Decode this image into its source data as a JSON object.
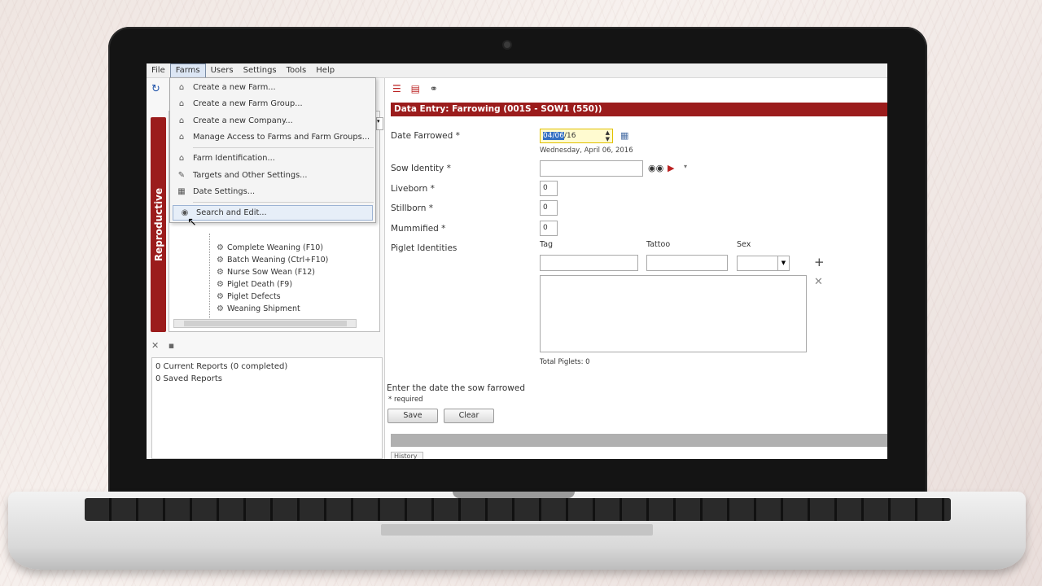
{
  "menubar": {
    "items": [
      "File",
      "Farms",
      "Users",
      "Settings",
      "Tools",
      "Help"
    ],
    "active": "Farms"
  },
  "farms_menu": {
    "items": [
      {
        "label": "Create a new Farm...",
        "icon": "farm-icon"
      },
      {
        "label": "Create a new Farm Group...",
        "icon": "farm-group-icon"
      },
      {
        "label": "Create a new Company...",
        "icon": "company-icon"
      },
      {
        "label": "Manage Access to Farms and Farm Groups...",
        "icon": "access-icon"
      },
      {
        "label": "Farm Identification...",
        "icon": "identification-icon"
      },
      {
        "label": "Targets and Other Settings...",
        "icon": "targets-icon"
      },
      {
        "label": "Date Settings...",
        "icon": "date-settings-icon"
      },
      {
        "label": "Search and Edit...",
        "icon": "binoculars-icon",
        "highlighted": true
      }
    ]
  },
  "sidebar": {
    "tab_label": "Reproductive",
    "tree_items": [
      "Complete Weaning (F10)",
      "Batch Weaning (Ctrl+F10)",
      "Nurse Sow Wean (F12)",
      "Piglet Death (F9)",
      "Piglet Defects",
      "Weaning Shipment"
    ]
  },
  "reports": {
    "current": "0 Current Reports (0 completed)",
    "saved": "0 Saved Reports"
  },
  "form": {
    "title": "Data Entry: Farrowing (001S - SOW1 (550))",
    "date_farrowed_label": "Date Farrowed *",
    "date_value_selected": "04/06",
    "date_value_rest": "/16",
    "date_long": "Wednesday, April 06, 2016",
    "sow_identity_label": "Sow Identity *",
    "liveborn_label": "Liveborn *",
    "liveborn_value": "0",
    "stillborn_label": "Stillborn *",
    "stillborn_value": "0",
    "mummified_label": "Mummified *",
    "mummified_value": "0",
    "piglet_identities_label": "Piglet Identities",
    "tag_label": "Tag",
    "tattoo_label": "Tattoo",
    "sex_label": "Sex",
    "total_piglets": "Total Piglets: 0",
    "hint": "Enter the date the sow farrowed",
    "required_note": "* required",
    "save_label": "Save",
    "clear_label": "Clear",
    "history_tab": "History"
  },
  "colors": {
    "accent": "#9b1c1c",
    "highlight": "#e6eef8"
  }
}
